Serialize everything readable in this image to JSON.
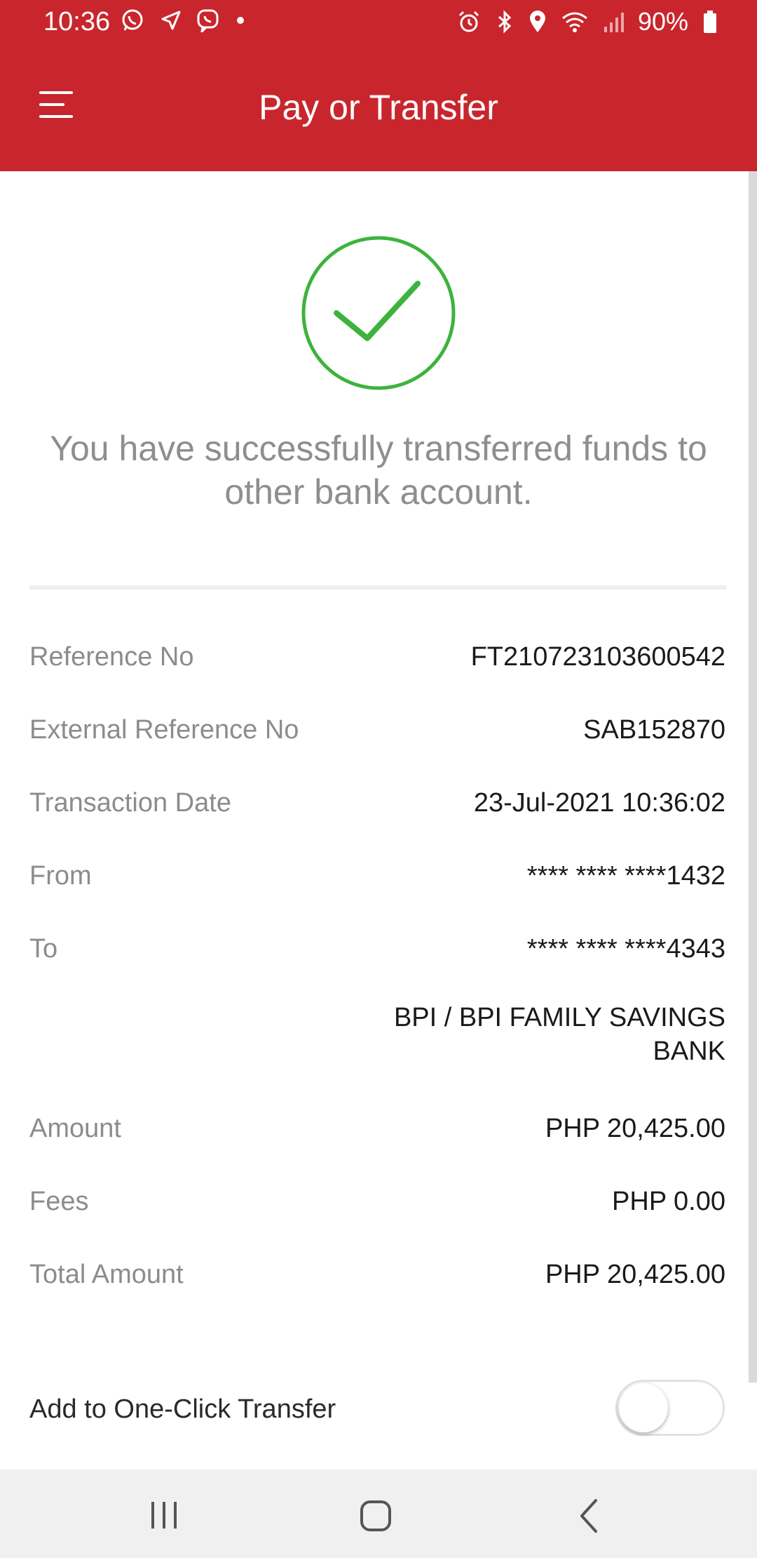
{
  "status_bar": {
    "time": "10:36",
    "battery": "90%",
    "left_icons": [
      "whatsapp-icon",
      "telegram-icon",
      "viber-icon",
      "dot-icon"
    ],
    "right_icons": [
      "alarm-icon",
      "bluetooth-icon",
      "location-icon",
      "wifi-icon",
      "signal-icon",
      "battery-icon"
    ]
  },
  "header": {
    "title": "Pay or Transfer",
    "menu_icon": "menu-icon"
  },
  "success": {
    "icon": "check-circle-icon",
    "message": "You have successfully transferred funds to other bank account.",
    "color": "#3db33d"
  },
  "details": [
    {
      "label": "Reference No",
      "value": "FT210723103600542"
    },
    {
      "label": "External Reference No",
      "value": "SAB152870"
    },
    {
      "label": "Transaction Date",
      "value": "23-Jul-2021 10:36:02"
    },
    {
      "label": "From",
      "value": "**** **** ****1432"
    },
    {
      "label": "To",
      "value": "**** **** ****4343"
    },
    {
      "label": "Amount",
      "value": "PHP 20,425.00"
    },
    {
      "label": "Fees",
      "value": "PHP 0.00"
    },
    {
      "label": "Total Amount",
      "value": "PHP 20,425.00"
    }
  ],
  "to_bank": "BPI / BPI FAMILY SAVINGS BANK",
  "one_click": {
    "label": "Add to One-Click Transfer",
    "enabled": false
  },
  "nav_bar": {
    "buttons": [
      "recent-apps-icon",
      "home-icon",
      "back-icon"
    ]
  },
  "colors": {
    "brand": "#c8262c",
    "success": "#3db33d"
  }
}
